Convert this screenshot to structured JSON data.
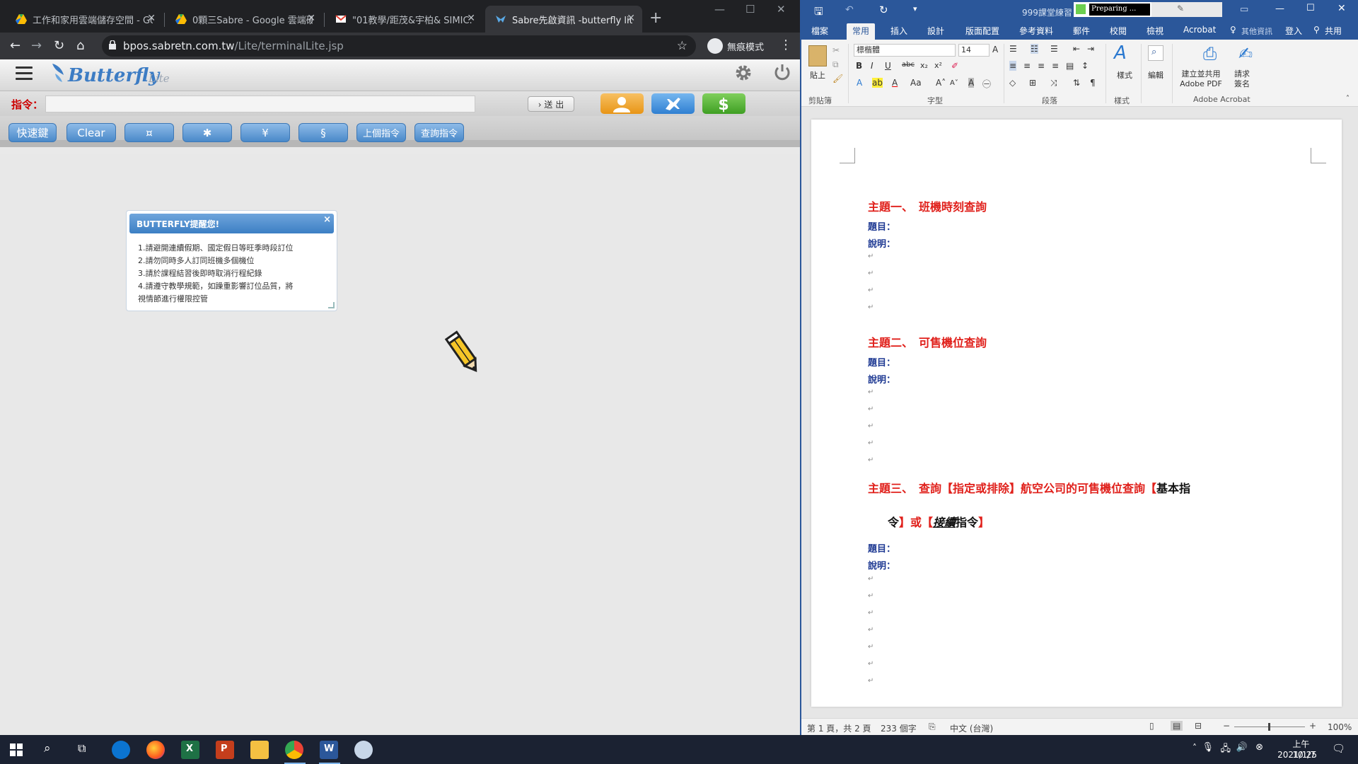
{
  "chrome": {
    "tabs": [
      {
        "title": "工作和家用雲端儲存空間 - Go..."
      },
      {
        "title": "0顆三Sabre - Google 雲端硬..."
      },
      {
        "title": "\"01教學/距茂&宇柏& SIMIC..."
      },
      {
        "title": "Sabre先啟資訊 -butterfly lite"
      }
    ],
    "new_tab": "+",
    "url_host": "bpos.sabretn.com.tw",
    "url_path": "/Lite/terminalLite.jsp",
    "incognito_label": "無痕模式"
  },
  "butterfly": {
    "logo": "Butterfly",
    "logo_sub": "Lite",
    "command_label": "指令：",
    "command_value": "",
    "send_button": "› 送 出",
    "quick_buttons": [
      "快速鍵",
      "Clear",
      "¤",
      "✱",
      "¥",
      "§",
      "上個指令",
      "查詢指令"
    ],
    "notice": {
      "title": "BUTTERFLY提醒您!",
      "close": "×",
      "items": [
        "1.請避開連續假期、國定假日等旺季時段訂位",
        "2.請勿同時多人訂同班機多個機位",
        "3.請於課程結習後即時取消行程紀錄",
        "4.請遵守教學規範，如躁重影響訂位品質，將",
        "視情節進行權限控管"
      ]
    }
  },
  "word": {
    "title_text": "999課堂練習",
    "preparing": "Preparing ...",
    "tabs": [
      "檔案",
      "常用",
      "插入",
      "設計",
      "版面配置",
      "參考資料",
      "郵件",
      "校閱",
      "檢視",
      "Acrobat"
    ],
    "active_tab": "常用",
    "tell_me": "其他資訊",
    "sign_in": "登入",
    "share": "共用",
    "ribbon": {
      "paste": "貼上",
      "font_name": "標楷體",
      "font_size": "14",
      "styles": "樣式",
      "edit": "編輯",
      "create_pdf": "建立並共用 Adobe PDF",
      "request_sign": "請求簽名",
      "groups": [
        "剪貼簿",
        "字型",
        "段落",
        "樣式",
        "Adobe Acrobat"
      ]
    },
    "document": {
      "topic1": "主題一、　班機時刻查詢",
      "topic2": "主題二、　可售機位查詢",
      "topic3_part1": "主題三、　查詢【指定或排除】航空公司的可售機位查詢【",
      "topic3_black1": "基本指",
      "topic3_line2_black": "令",
      "topic3_line2_red1": "】或【",
      "topic3_line2_ital": "接續",
      "topic3_line2_black2": "指令",
      "topic3_line2_red2": "】",
      "q_label": "題目：",
      "desc_label": "說明：",
      "para_mark": "↵"
    },
    "status": {
      "page": "第 1 頁，共 2 頁",
      "words": "233 個字",
      "language": "中文 (台灣)",
      "zoom": "100%"
    }
  },
  "taskbar": {
    "time": "上午 10:25",
    "date": "2021/1/7"
  },
  "colors": {
    "word_blue": "#2b579a",
    "chrome_dark": "#202124",
    "heading_red": "#e0201b",
    "label_blue": "#1f3a93"
  }
}
